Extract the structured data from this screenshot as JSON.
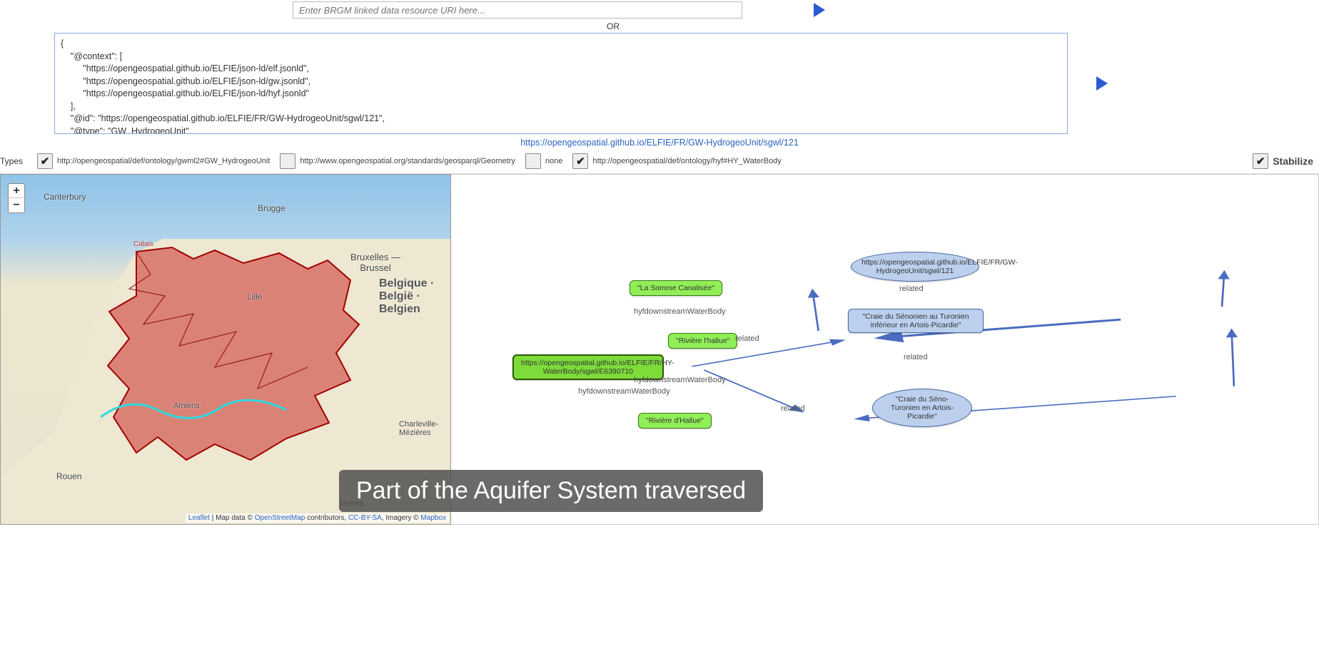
{
  "uri_input": {
    "placeholder": "Enter BRGM linked data resource URI here..."
  },
  "or_label": "OR",
  "json_text": "{\n    \"@context\": [\n         \"https://opengeospatial.github.io/ELFIE/json-ld/elf.jsonld\",\n         \"https://opengeospatial.github.io/ELFIE/json-ld/gw.jsonld\",\n         \"https://opengeospatial.github.io/ELFIE/json-ld/hyf.jsonld\"\n    ],\n    \"@id\": \"https://opengeospatial.github.io/ELFIE/FR/GW-HydrogeoUnit/sgwl/121\",\n    \"@type\": \"GW_HydrogeoUnit\",\n    \"name\": \"Grand système multicouche du Campanien au Turonien (Séno-Turonien) du Bassin Parisien\",\n    \"related\": [",
  "resource_link": "https://opengeospatial.github.io/ELFIE/FR/GW-HydrogeoUnit/sgwl/121",
  "types": {
    "label": "Types",
    "items": [
      {
        "checked": true,
        "text": "http://opengeospatial/def/ontology/gwml2#GW_HydrogeoUnit"
      },
      {
        "checked": false,
        "text": "http://www.opengeospatial.org/standards/geosparql/Geometry"
      },
      {
        "checked": false,
        "text": "none"
      },
      {
        "checked": true,
        "text": "http://opengeospatial/def/ontology/hyf#HY_WaterBody"
      }
    ]
  },
  "stabilize_label": "Stabilize",
  "map_labels": {
    "canterbury": "Canterbury",
    "brugge": "Brugge",
    "bruxelles": "Bruxelles —\nBrussel",
    "belgique": "Belgique ·\nBelgië ·\nBelgien",
    "lille": "Lille",
    "rouen": "Rouen",
    "reims": "Reims",
    "amiens": "Amiens",
    "charleville": "Charleville-\nMézières",
    "calais": "Calais"
  },
  "attribution": {
    "leaflet": "Leaflet",
    "mapdata": " | Map data © ",
    "osm": "OpenStreetMap",
    "contrib": " contributors, ",
    "cc": "CC-BY-SA",
    "imagery": ", Imagery © ",
    "mapbox": "Mapbox"
  },
  "graph": {
    "nodes": {
      "somme": "\"La Somme Canalisée\"",
      "riv_hallue": "\"Rivière l'hallue\"",
      "waterbody_uri": "https://opengeospatial.github.io/ELFIE/FR/HY-WaterBody/sgwl/E6390710",
      "riv_dhallue": "\"Rivière d'Hallue\"",
      "hydrogeo_uri": "https://opengeospatial.github.io/ELFIE/FR/GW-HydrogeoUnit/sgwl/121",
      "craie_senonien": "\"Craie du Sénonien au Turonien inférieur en Artois-Picardie\"",
      "craie_seno_turonien": "\"Craie du Séno-Turonien  en Artois-Picardie\""
    },
    "edges": {
      "down1": "hyfdownstreamWaterBody",
      "down2": "hyfdownstreamWaterBody",
      "down3": "hyfdownstreamWaterBody",
      "rel1": "related",
      "rel2": "related",
      "rel3": "related",
      "rel4": "related"
    }
  },
  "caption": "Part of the Aquifer System traversed"
}
